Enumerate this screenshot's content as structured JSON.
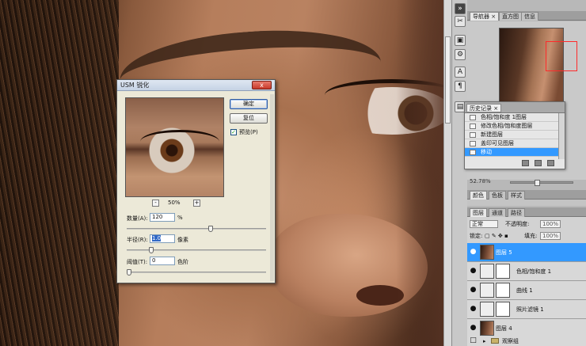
{
  "usm_dialog": {
    "title": "USM 锐化",
    "close_label": "x",
    "ok_label": "确定",
    "reset_label": "复位",
    "preview_label": "预览(P)",
    "preview_checked": true,
    "zoom_minus": "-",
    "zoom_plus": "+",
    "zoom_level": "50%",
    "amount_label": "数量(A):",
    "amount_value": "120",
    "amount_unit": "%",
    "radius_label": "半径(R):",
    "radius_value": "1.0",
    "radius_unit": "像素",
    "threshold_label": "阈值(T):",
    "threshold_value": "0",
    "threshold_unit": "色阶"
  },
  "navigator": {
    "tabs": [
      "导航器",
      "直方图",
      "信息"
    ],
    "tab_close": "×",
    "zoom_text": "52.78%"
  },
  "history": {
    "tab_label": "历史记录",
    "tab_close": "×",
    "items": [
      {
        "label": "色相/饱和度 1图层"
      },
      {
        "label": "修改色相/饱和度图层"
      },
      {
        "label": "新建图层"
      },
      {
        "label": "盖印可见图层"
      },
      {
        "label": "移动"
      }
    ],
    "selected_index": 4
  },
  "color_panel": {
    "tabs": [
      "颜色",
      "色板",
      "样式"
    ]
  },
  "layers_panel": {
    "tabs": [
      "图层",
      "通道",
      "路径"
    ],
    "blend_mode": "正常",
    "opacity_label": "不透明度:",
    "opacity_value": "100%",
    "lock_label": "锁定:",
    "fill_label": "填充:",
    "fill_value": "100%",
    "layers": [
      {
        "name": "图层 5",
        "kind": "photo",
        "selected": true
      },
      {
        "name": "色相/饱和度 1",
        "kind": "adjustment",
        "selected": false
      },
      {
        "name": "曲线 1",
        "kind": "adjustment",
        "selected": false
      },
      {
        "name": "照片滤镜 1",
        "kind": "adjustment",
        "selected": false
      },
      {
        "name": "图层 4",
        "kind": "photo",
        "selected": false
      },
      {
        "name": "观察组",
        "kind": "group",
        "selected": false
      }
    ]
  },
  "colors": {
    "selection": "#3399ff",
    "navigator_box": "#ff2a2a"
  }
}
